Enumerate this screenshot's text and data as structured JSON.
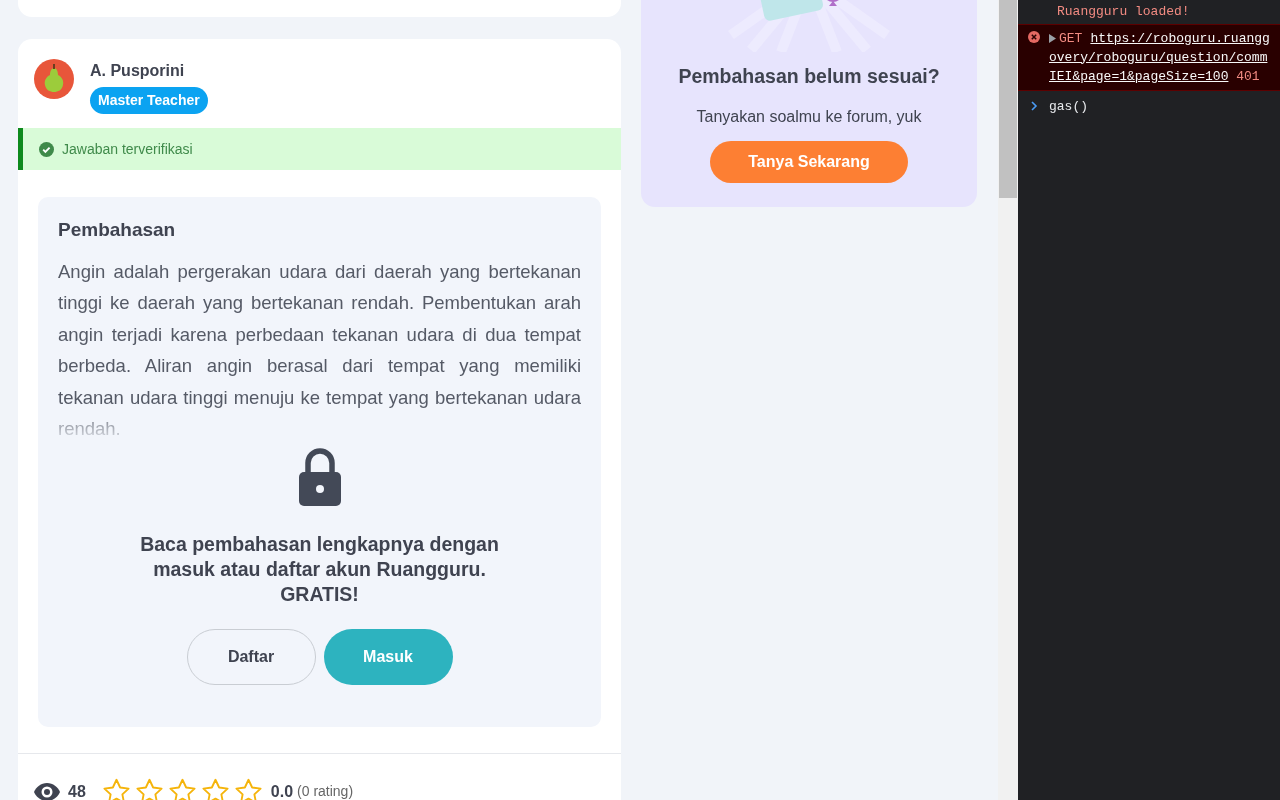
{
  "answer_card": {
    "author": {
      "name": "A. Pusporini",
      "badge": "Master Teacher"
    },
    "verified": {
      "label": "Jawaban terverifikasi",
      "on": true
    },
    "explanation": {
      "title": "Pembahasan",
      "text": "Angin adalah pergerakan udara dari daerah yang bertekanan tinggi ke daerah yang bertekanan rendah. Pembentukan arah angin terjadi karena perbedaan tekanan udara di dua tempat berbeda. Aliran angin berasal dari tempat yang memiliki tekanan udara tinggi menuju ke tempat yang bertekanan udara rendah."
    },
    "lock": {
      "message_lines": [
        "Baca pembahasan lengkapnya dengan",
        "masuk atau daftar akun Ruangguru.",
        "GRATIS!"
      ],
      "buttons": [
        {
          "label": "Daftar",
          "kind": "outline"
        },
        {
          "label": "Masuk",
          "kind": "primary"
        }
      ]
    },
    "footer": {
      "views": "48",
      "stars": 0,
      "rating": "0.0",
      "rating_count": "(0 rating)"
    }
  },
  "help_card": {
    "title": "Pembahasan belum sesuai?",
    "subtitle": "Tanyakan soalmu ke forum, yuk",
    "button": "Tanya Sekarang"
  },
  "console": {
    "entries": [
      {
        "kind": "log",
        "text": "Ruangguru loaded!"
      },
      {
        "kind": "error",
        "method": "GET",
        "url_lines": [
          "https://roboguru.ruangg",
          "overy/roboguru/question/comm",
          "IEI&page=1&pageSize=100"
        ],
        "status": "401"
      },
      {
        "kind": "input",
        "text": "gas()"
      }
    ]
  }
}
